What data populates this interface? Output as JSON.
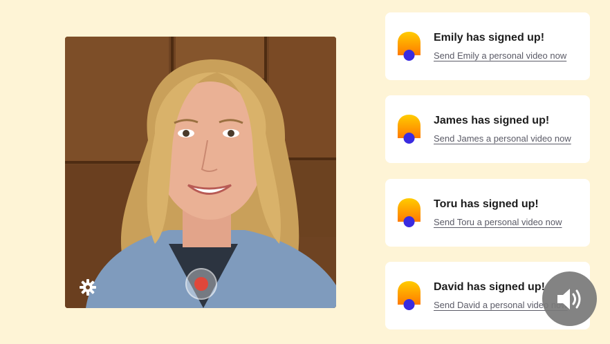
{
  "colors": {
    "page_background": "#fef4d6",
    "card_background": "#ffffff",
    "logo_top": "#ffcc00",
    "logo_bottom": "#ff7a00",
    "logo_dot": "#3a2be0",
    "record_red": "#e0473a"
  },
  "video": {
    "settings_icon": "gear-icon",
    "record_icon": "record-icon"
  },
  "notifications": [
    {
      "title": "Emily has signed up!",
      "link": "Send Emily a personal video now"
    },
    {
      "title": "James has signed up!",
      "link": "Send James a personal video now"
    },
    {
      "title": "Toru has signed up!",
      "link": "Send Toru a personal video now"
    },
    {
      "title": "David has signed up!",
      "link": "Send David a personal video now"
    }
  ],
  "sound_button": {
    "icon": "speaker-volume-icon"
  }
}
